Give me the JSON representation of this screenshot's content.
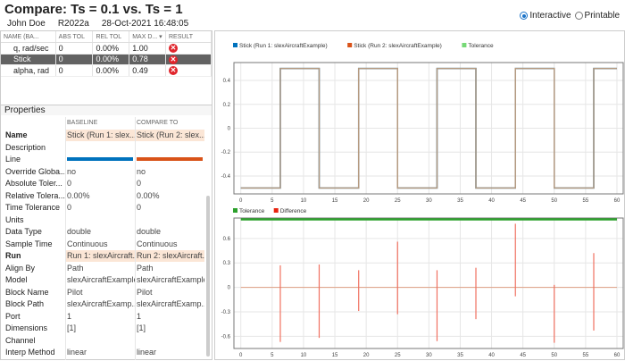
{
  "header": {
    "title": "Compare: Ts = 0.1 vs. Ts = 1",
    "user": "John Doe",
    "release": "R2022a",
    "datetime": "28-Oct-2021 16:48:05"
  },
  "view_mode": {
    "options": [
      "Interactive",
      "Printable"
    ],
    "selected": "Interactive"
  },
  "signals_table": {
    "columns": [
      "NAME (BA...",
      "ABS TOL",
      "REL TOL",
      "MAX D...",
      "RESULT"
    ],
    "sort_column": "MAX D...",
    "rows": [
      {
        "name": "q, rad/sec",
        "abs_tol": "0",
        "rel_tol": "0.00%",
        "max_diff": "1.00",
        "result": "fail"
      },
      {
        "name": "Stick",
        "abs_tol": "0",
        "rel_tol": "0.00%",
        "max_diff": "0.78",
        "result": "fail",
        "selected": true
      },
      {
        "name": "alpha, rad",
        "abs_tol": "0",
        "rel_tol": "0.00%",
        "max_diff": "0.49",
        "result": "fail"
      }
    ]
  },
  "properties": {
    "title": "Properties",
    "columns": [
      "BASELINE",
      "COMPARE TO"
    ],
    "colors": {
      "baseline": "#0072bd",
      "compare": "#d95319"
    },
    "rows": [
      {
        "k": "Name",
        "a": "Stick (Run 1: slex...",
        "b": "Stick (Run 2: slex...",
        "bold": true,
        "hl": true
      },
      {
        "k": "Description",
        "a": "",
        "b": ""
      },
      {
        "k": "Line",
        "a": "",
        "b": "",
        "line": true
      },
      {
        "k": "Override Globa...",
        "a": "no",
        "b": "no"
      },
      {
        "k": "Absolute Toler...",
        "a": "0",
        "b": "0"
      },
      {
        "k": "Relative Tolera...",
        "a": "0.00%",
        "b": "0.00%"
      },
      {
        "k": "Time Tolerance",
        "a": "0",
        "b": "0"
      },
      {
        "k": "Units",
        "a": "",
        "b": ""
      },
      {
        "k": "Data Type",
        "a": "double",
        "b": "double"
      },
      {
        "k": "Sample Time",
        "a": "Continuous",
        "b": "Continuous"
      },
      {
        "k": "Run",
        "a": "Run 1: slexAircraft...",
        "b": "Run 2: slexAircraft...",
        "bold": true,
        "hl": true
      },
      {
        "k": "Align By",
        "a": "Path",
        "b": "Path"
      },
      {
        "k": "Model",
        "a": "slexAircraftExample",
        "b": "slexAircraftExample"
      },
      {
        "k": "Block Name",
        "a": "Pilot",
        "b": "Pilot"
      },
      {
        "k": "Block Path",
        "a": "slexAircraftExamp...",
        "b": "slexAircraftExamp..."
      },
      {
        "k": "Port",
        "a": "1",
        "b": "1"
      },
      {
        "k": "Dimensions",
        "a": "[1]",
        "b": "[1]"
      },
      {
        "k": "Channel",
        "a": "",
        "b": ""
      },
      {
        "k": "Interp Method",
        "a": "linear",
        "b": "linear"
      }
    ]
  },
  "chart_data": [
    {
      "type": "line",
      "legend": [
        {
          "name": "Stick (Run 1: slexAircraftExample)",
          "color": "#0072bd"
        },
        {
          "name": "Stick (Run 2: slexAircraftExample)",
          "color": "#d95319"
        },
        {
          "name": "Tolerance",
          "color": "#77d977"
        }
      ],
      "xlim": [
        -1.1,
        61
      ],
      "ylim": [
        -0.55,
        0.55
      ],
      "xticks": [
        0,
        5,
        10,
        15,
        20,
        25,
        30,
        35,
        40,
        45,
        50,
        55,
        60
      ],
      "yticks": [
        0.4,
        0.2,
        0,
        -0.2,
        -0.4
      ],
      "grid": true,
      "square_wave": {
        "low": -0.5,
        "high": 0.5,
        "transitions": [
          6.3,
          12.5,
          18.8,
          25,
          31.3,
          37.5,
          43.8,
          50,
          56.3
        ],
        "x_end": 60
      }
    },
    {
      "type": "line",
      "legend": [
        {
          "name": "Tolerance",
          "color": "#2ca02c"
        },
        {
          "name": "Difference",
          "color": "#e8230f"
        }
      ],
      "xlim": [
        -1.1,
        61
      ],
      "ylim": [
        -0.75,
        0.85
      ],
      "xticks": [
        0,
        5,
        10,
        15,
        20,
        25,
        30,
        35,
        40,
        45,
        50,
        55,
        60
      ],
      "yticks": [
        0.6,
        0.3,
        0,
        -0.3,
        -0.6
      ],
      "grid": true,
      "spikes": [
        {
          "x": 6.3,
          "max": 0.27,
          "min": -0.67
        },
        {
          "x": 12.5,
          "max": 0.28,
          "min": -0.62
        },
        {
          "x": 18.8,
          "max": 0.21,
          "min": -0.29
        },
        {
          "x": 25,
          "max": 0.56,
          "min": -0.33
        },
        {
          "x": 31.3,
          "max": 0.21,
          "min": -0.66
        },
        {
          "x": 37.5,
          "max": 0.24,
          "min": -0.39
        },
        {
          "x": 43.8,
          "max": 0.78,
          "min": -0.11
        },
        {
          "x": 50,
          "max": 0.03,
          "min": -0.68
        },
        {
          "x": 56.3,
          "max": 0.42,
          "min": -0.53
        }
      ]
    }
  ]
}
